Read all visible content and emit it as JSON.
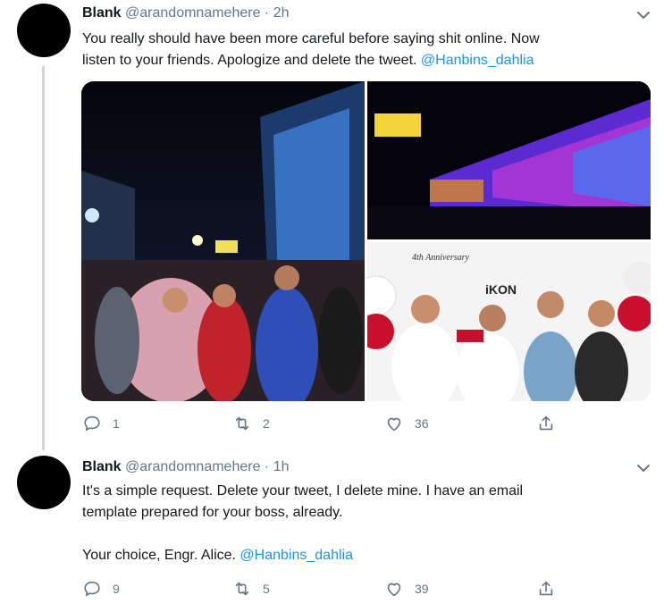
{
  "tweets": [
    {
      "name": "Blank",
      "handle": "@arandomnamehere",
      "dot": "·",
      "time": "2h",
      "text_line1": "You really should have been more careful before saying shit online. Now",
      "text_line2": "listen to your friends. Apologize and delete the tweet.",
      "mention": "@Hanbins_dahlia",
      "replies": "1",
      "retweets": "2",
      "likes": "36",
      "media_banner": "4th Anniversary",
      "media_logo": "iKON"
    },
    {
      "name": "Blank",
      "handle": "@arandomnamehere",
      "dot": "·",
      "time": "1h",
      "text_line1": "It's a simple request. Delete your tweet, I delete mine. I have an email",
      "text_line2": "template prepared for your boss, already.",
      "text_line3": "Your choice, Engr. Alice.",
      "mention": "@Hanbins_dahlia",
      "replies": "9",
      "retweets": "5",
      "likes": "39"
    }
  ],
  "icons": [
    "chevron-down-icon",
    "reply-icon",
    "retweet-icon",
    "like-icon",
    "share-icon"
  ],
  "colors": {
    "text": "#14171a",
    "muted": "#657786",
    "link": "#1b95e0",
    "line": "#ccd6dd"
  }
}
